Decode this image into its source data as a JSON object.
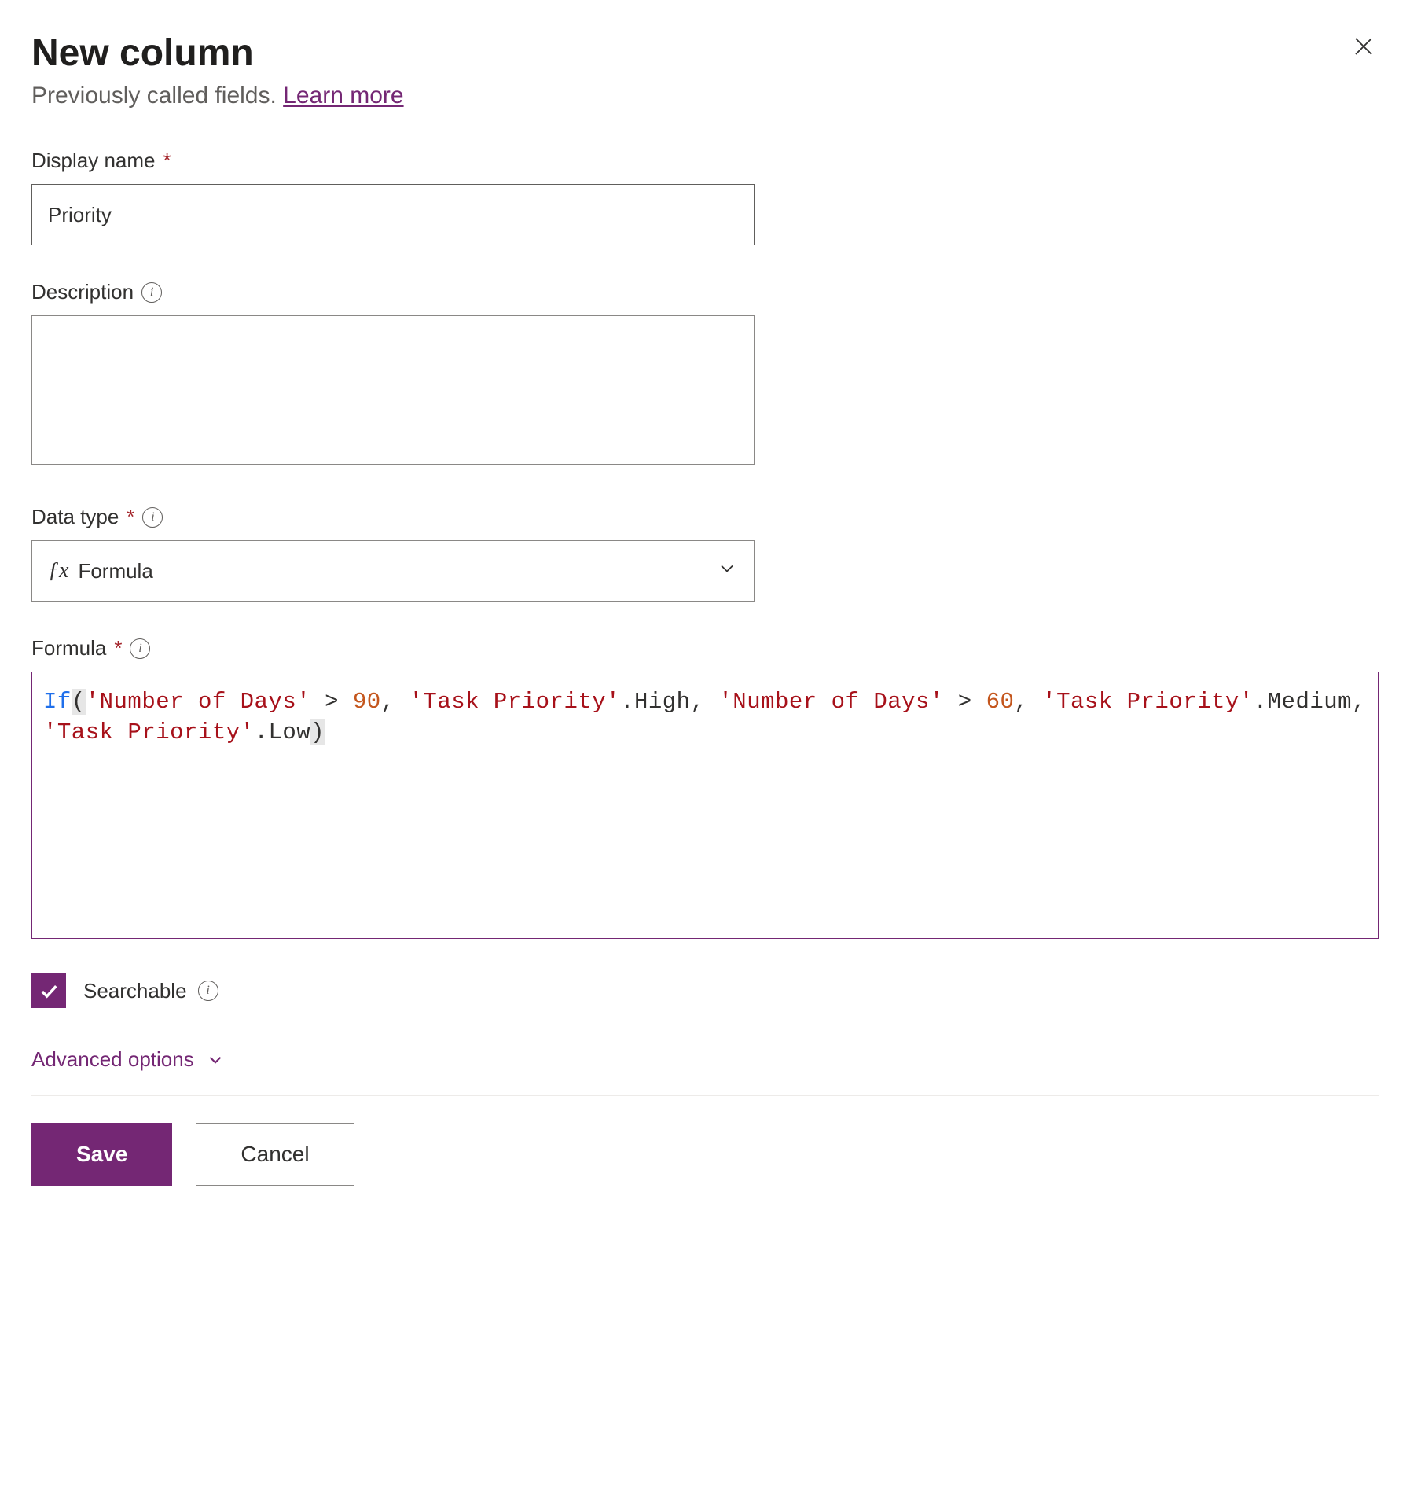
{
  "header": {
    "title": "New column",
    "subtitle_text": "Previously called fields. ",
    "learn_more": "Learn more"
  },
  "fields": {
    "display_name": {
      "label": "Display name",
      "value": "Priority"
    },
    "description": {
      "label": "Description",
      "value": ""
    },
    "data_type": {
      "label": "Data type",
      "selected": "Formula"
    },
    "formula": {
      "label": "Formula",
      "tokens": [
        {
          "t": "func",
          "v": "If"
        },
        {
          "t": "paren",
          "v": "("
        },
        {
          "t": "str",
          "v": "'Number of Days'"
        },
        {
          "t": "plain",
          "v": " "
        },
        {
          "t": "op",
          "v": ">"
        },
        {
          "t": "plain",
          "v": " "
        },
        {
          "t": "num",
          "v": "90"
        },
        {
          "t": "op",
          "v": ","
        },
        {
          "t": "plain",
          "v": " "
        },
        {
          "t": "str",
          "v": "'Task Priority'"
        },
        {
          "t": "plain",
          "v": ".High"
        },
        {
          "t": "op",
          "v": ","
        },
        {
          "t": "plain",
          "v": " "
        },
        {
          "t": "str",
          "v": "'Number of Days'"
        },
        {
          "t": "plain",
          "v": " "
        },
        {
          "t": "op",
          "v": ">"
        },
        {
          "t": "plain",
          "v": " "
        },
        {
          "t": "num",
          "v": "60"
        },
        {
          "t": "op",
          "v": ","
        },
        {
          "t": "plain",
          "v": " "
        },
        {
          "t": "str",
          "v": "'Task Priority'"
        },
        {
          "t": "plain",
          "v": ".Medium"
        },
        {
          "t": "op",
          "v": ","
        },
        {
          "t": "plain",
          "v": " "
        },
        {
          "t": "str",
          "v": "'Task Priority'"
        },
        {
          "t": "plain",
          "v": ".Low"
        },
        {
          "t": "paren",
          "v": ")"
        }
      ]
    }
  },
  "searchable": {
    "label": "Searchable",
    "checked": true
  },
  "advanced_options": "Advanced options",
  "buttons": {
    "save": "Save",
    "cancel": "Cancel"
  }
}
